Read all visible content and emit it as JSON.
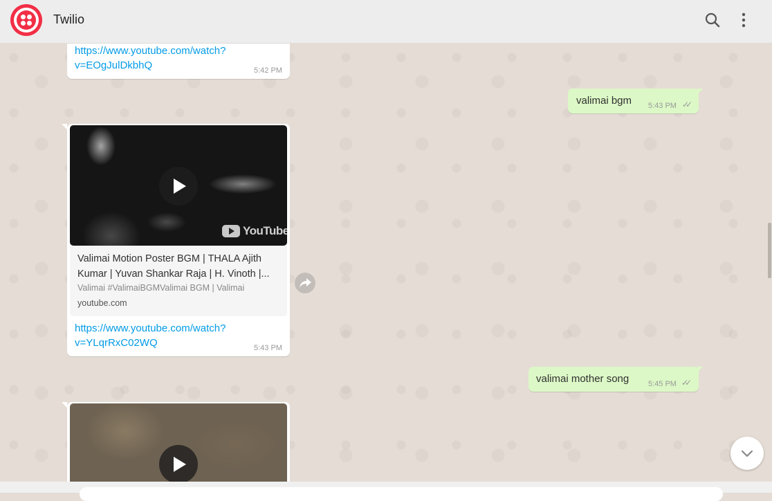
{
  "header": {
    "contact_name": "Twilio",
    "search_icon": "search-icon",
    "menu_icon": "more-vertical-icon"
  },
  "messages": {
    "m1": {
      "link": "https://www.youtube.com/watch?v=EOgJulDkbhQ",
      "link_line1": "https://www.youtube.com/watch?",
      "link_line2": "v=EOgJulDkbhQ",
      "time": "5:42 PM"
    },
    "m2": {
      "text": "valimai bgm",
      "time": "5:43 PM",
      "status": "read"
    },
    "m3": {
      "preview_title": "Valimai Motion Poster BGM | THALA Ajith Kumar | Yuvan Shankar Raja | H. Vinoth |...",
      "preview_desc": "Valimai #ValimaiBGMValimai BGM | Valimai",
      "preview_site": "youtube.com",
      "thumb_brand": "YouTube",
      "link": "https://www.youtube.com/watch?v=YLqrRxC02WQ",
      "link_line1": "https://www.youtube.com/watch?",
      "link_line2": "v=YLqrRxC02WQ",
      "time": "5:43 PM"
    },
    "m4": {
      "text": "valimai mother song",
      "time": "5:45 PM",
      "status": "read"
    }
  },
  "colors": {
    "brand_red": "#f22f46",
    "outgoing_bubble": "#dcf8c6",
    "incoming_bubble": "#ffffff",
    "chat_background": "#e5ddd5",
    "link": "#039be5"
  }
}
